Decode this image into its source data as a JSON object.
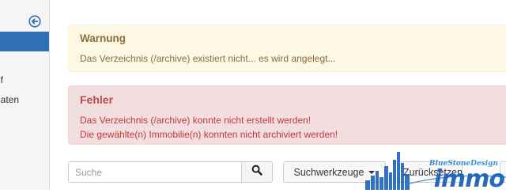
{
  "sidebar": {
    "items": [
      {
        "label": "uf"
      },
      {
        "label": "naten"
      }
    ]
  },
  "alerts": {
    "warning": {
      "heading": "Warnung",
      "message": "Das Verzeichnis (/archive) existiert nicht... es wird angelegt..."
    },
    "danger": {
      "heading": "Fehler",
      "messages": [
        "Das Verzeichnis (/archive) konnte nicht erstellt werden!",
        "Die gewählte(n) Immobilie(n) konnten nicht archiviert werden!"
      ]
    }
  },
  "toolbar": {
    "search_placeholder": "Suche",
    "search_icon": "search-icon",
    "tools_label": "Suchwerkzeuge",
    "reset_label": "Zurücksetzen"
  },
  "watermark": {
    "tagline": "BlueStoneDesign",
    "brand": "immo"
  },
  "colors": {
    "sidebar_active": "#2f6fb4",
    "warning_bg": "#fcf8e3",
    "warning_text": "#8a6d3b",
    "danger_bg": "#f2dede",
    "danger_text": "#b94a48",
    "watermark_blue": "#1c63b8"
  }
}
